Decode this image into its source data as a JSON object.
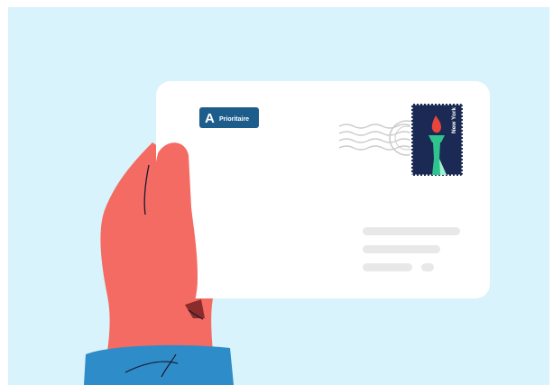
{
  "illustration": {
    "priority_label": {
      "letter": "A",
      "text": "Prioritaire"
    },
    "stamp": {
      "text": "New York"
    },
    "colors": {
      "background": "#d8f3fb",
      "envelope": "#ffffff",
      "label": "#1d5d8c",
      "stamp_background": "#1b2a55",
      "hand": "#f36b63",
      "sleeve": "#2e8cc8",
      "postmark": "#cccccc",
      "address_lines": "#e8e8e8"
    }
  }
}
